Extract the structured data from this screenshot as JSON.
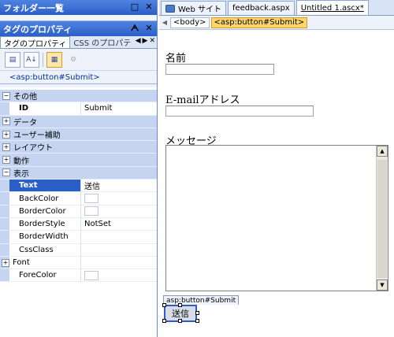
{
  "folder_pane": {
    "title": "フォルダー一覧"
  },
  "tag_props_pane": {
    "title": "タグのプロパティ",
    "tabs": [
      {
        "label": "タグのプロパティ"
      },
      {
        "label": "CSS のプロパテ"
      }
    ],
    "selector": "<asp:button#Submit>",
    "rows": [
      {
        "kind": "category",
        "expander": "⊟",
        "label": "その他"
      },
      {
        "kind": "prop",
        "name": "ID",
        "value": "Submit",
        "style": "bold"
      },
      {
        "kind": "category",
        "expander": "⊞",
        "label": "データ"
      },
      {
        "kind": "category",
        "expander": "⊞",
        "label": "ユーザー補助"
      },
      {
        "kind": "category",
        "expander": "⊞",
        "label": "レイアウト"
      },
      {
        "kind": "category",
        "expander": "⊞",
        "label": "動作"
      },
      {
        "kind": "category",
        "expander": "⊟",
        "label": "表示"
      },
      {
        "kind": "prop",
        "name": "Text",
        "value": "送信",
        "style": "selected"
      },
      {
        "kind": "prop",
        "name": "BackColor",
        "value": "",
        "swatch": true
      },
      {
        "kind": "prop",
        "name": "BorderColor",
        "value": "",
        "swatch": true
      },
      {
        "kind": "prop",
        "name": "BorderStyle",
        "value": "NotSet"
      },
      {
        "kind": "prop",
        "name": "BorderWidth",
        "value": ""
      },
      {
        "kind": "prop",
        "name": "CssClass",
        "value": ""
      },
      {
        "kind": "prop",
        "name": "Font",
        "value": "",
        "expander": "⊞"
      },
      {
        "kind": "prop",
        "name": "ForeColor",
        "value": "",
        "swatch": true
      }
    ]
  },
  "editor": {
    "tabs": [
      {
        "label": "Web サイト",
        "icon": "web-site-icon"
      },
      {
        "label": "feedback.aspx"
      },
      {
        "label": "Untitled 1.ascx*",
        "active": true
      }
    ],
    "tag_bar": [
      {
        "label": "<body>"
      },
      {
        "label": "<asp:button#Submit>",
        "active": true
      }
    ],
    "form": {
      "name_label": "名前",
      "email_label": "E-mailアドレス",
      "message_label": "メッセージ",
      "control_tag": "asp:button#Submit",
      "submit_label": "送信"
    }
  }
}
